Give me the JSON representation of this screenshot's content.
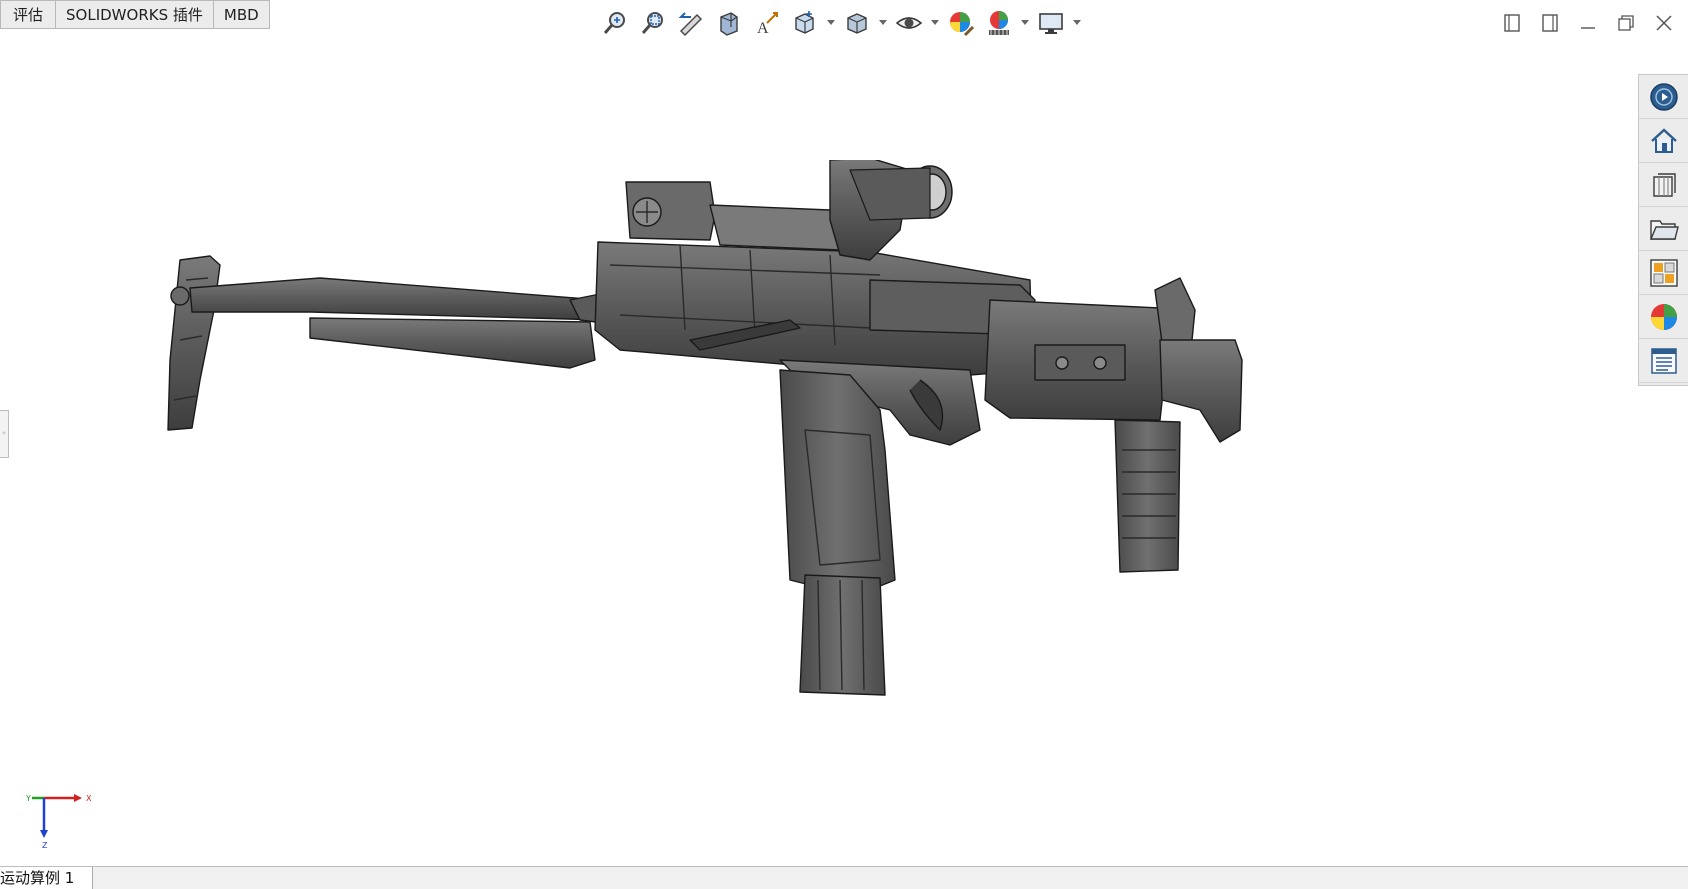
{
  "tabs": [
    {
      "label": "评估"
    },
    {
      "label": "SOLIDWORKS 插件"
    },
    {
      "label": "MBD"
    }
  ],
  "hud_toolbar": {
    "icons": [
      "zoom-to-fit-icon",
      "zoom-to-area-icon",
      "previous-view-icon",
      "section-view-icon",
      "dynamic-annotation-icon",
      "view-orientation-icon",
      "display-style-icon",
      "hide-show-items-icon",
      "edit-appearance-icon",
      "apply-scene-icon",
      "view-settings-icon"
    ]
  },
  "task_pane": {
    "icons": [
      "solidworks-resources-icon",
      "home-icon",
      "design-library-icon",
      "file-explorer-icon",
      "view-palette-icon",
      "appearances-scenes-icon",
      "custom-properties-icon"
    ]
  },
  "triad": {
    "x_label": "X",
    "y_label": "Y",
    "z_label": "Z"
  },
  "bottom_bar": {
    "motion_tab": "运动算例 1"
  },
  "colors": {
    "accent": "#2060b0",
    "model": "#5a5a5a",
    "triad_x": "#d02020",
    "triad_y": "#20a020",
    "triad_z": "#2040d0"
  }
}
